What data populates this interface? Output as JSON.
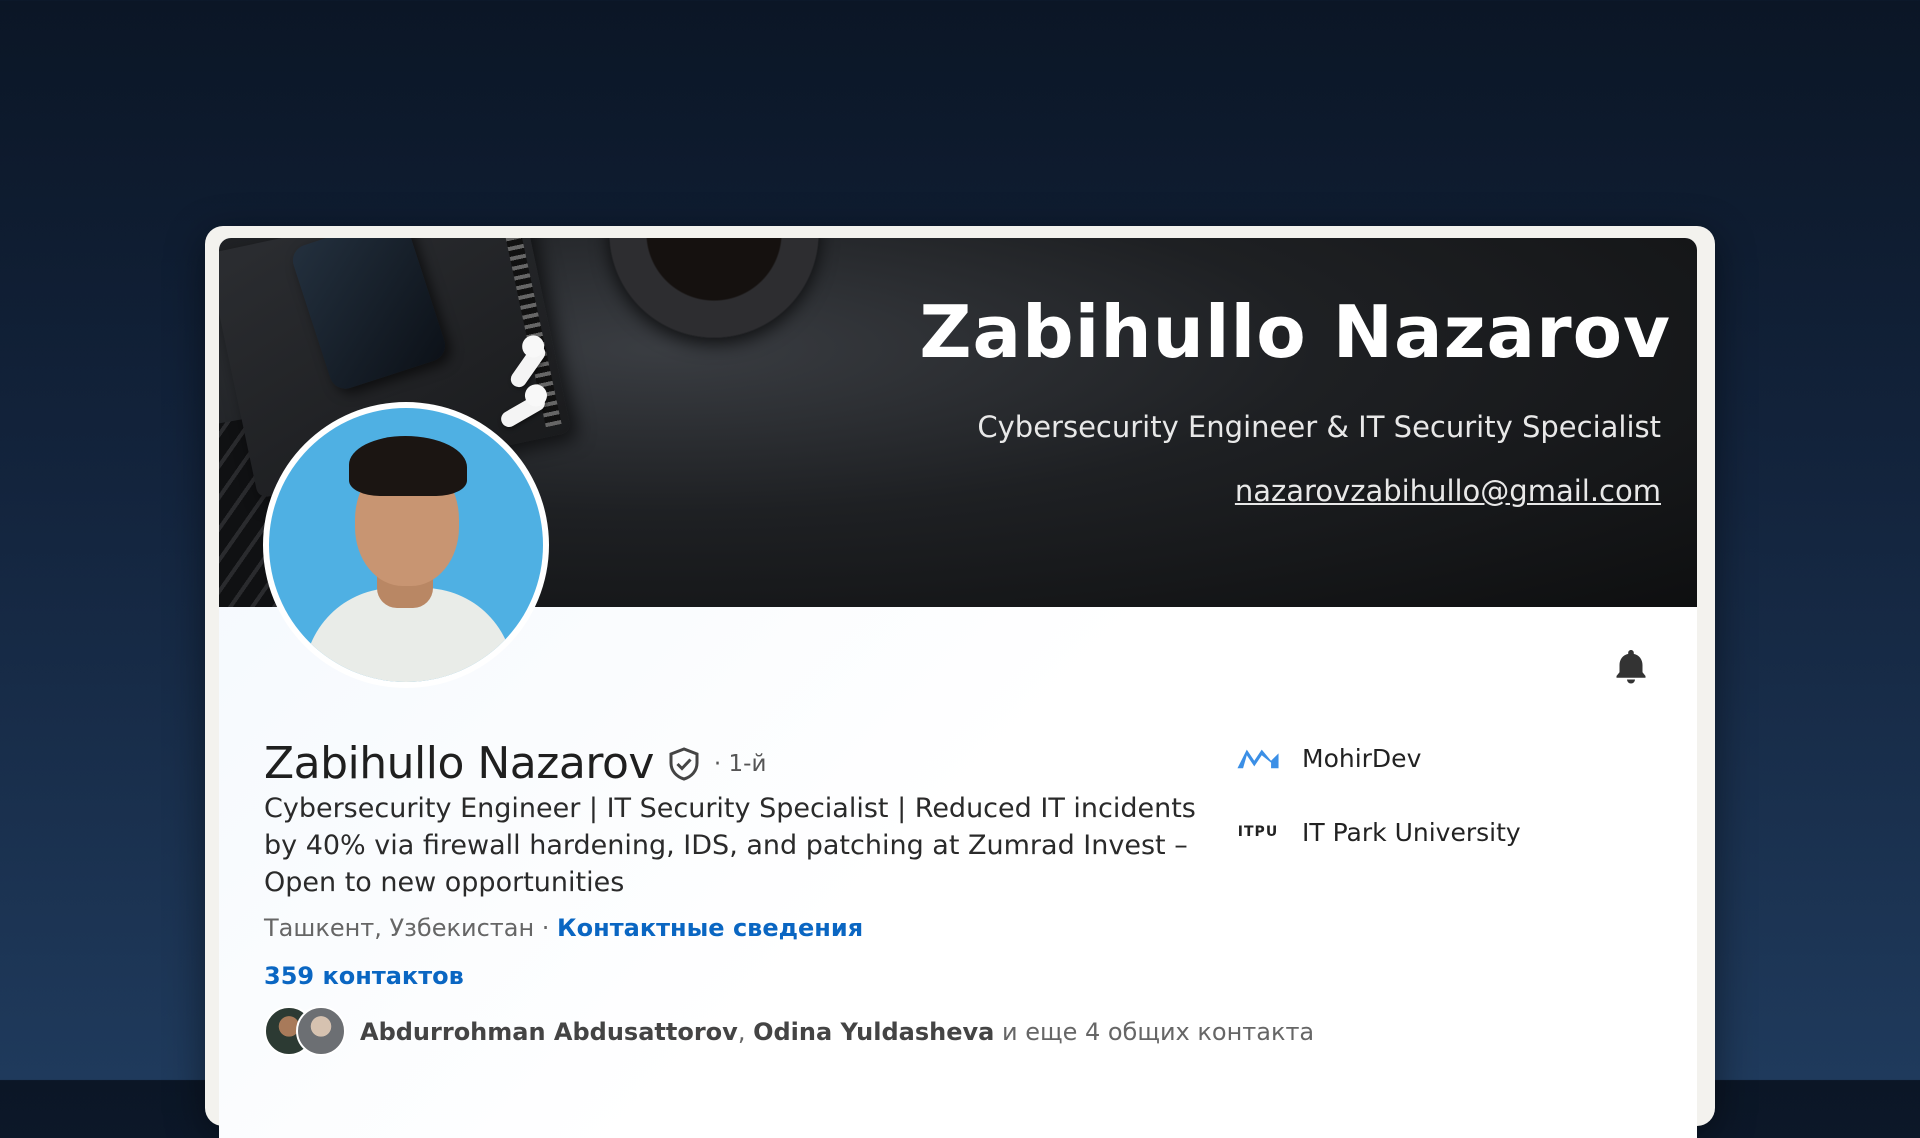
{
  "banner": {
    "name": "Zabihullo Nazarov",
    "subtitle": "Cybersecurity Engineer & IT Security Specialist",
    "email": "nazarovzabihullo@gmail.com"
  },
  "profile": {
    "name": "Zabihullo Nazarov",
    "degree": "· 1-й",
    "headline": "Cybersecurity Engineer | IT Security Specialist | Reduced IT incidents by 40% via firewall hardening, IDS, and patching at Zumrad Invest – Open to new opportunities",
    "location": "Ташкент, Узбекистан",
    "separator": " · ",
    "contact_info_label": "Контактные сведения",
    "connections": "359 контактов",
    "mutual": {
      "name_1": "Abdurrohman Abdusattorov",
      "comma": ", ",
      "name_2": "Odina Yuldasheva",
      "rest": " и еще 4 общих контакта"
    }
  },
  "organizations": [
    {
      "name": "MohirDev",
      "logo": "mohirdev-logo"
    },
    {
      "name": "IT Park University",
      "logo": "itpu-logo",
      "logo_text": "ITPU"
    }
  ],
  "colors": {
    "link": "#0a66c2",
    "banner_bg": "#1e2023",
    "avatar_bg": "#4fb0e3",
    "mohirdev_blue": "#3b8fe6"
  },
  "icons": {
    "bell": "bell-icon",
    "verified": "verified-shield-icon"
  }
}
